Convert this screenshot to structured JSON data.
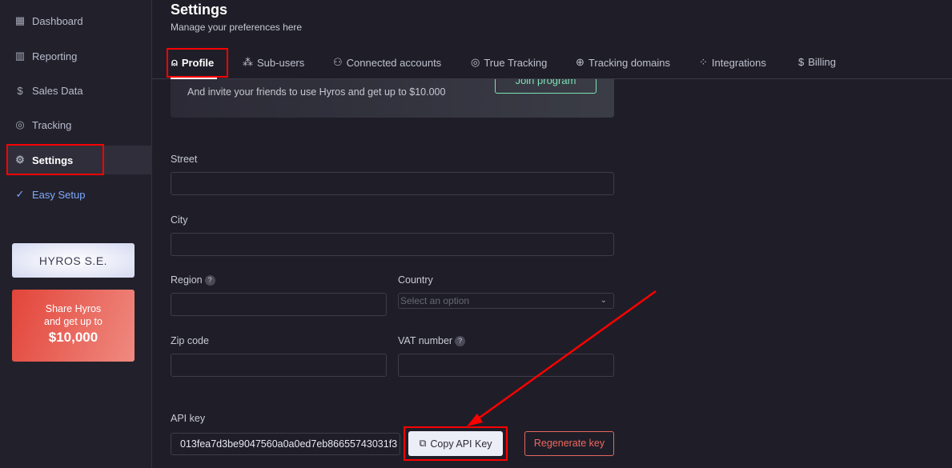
{
  "sidebar": {
    "items": [
      {
        "label": "Dashboard",
        "icon": "grid-icon"
      },
      {
        "label": "Reporting",
        "icon": "chart-icon"
      },
      {
        "label": "Sales Data",
        "icon": "dollar-icon"
      },
      {
        "label": "Tracking",
        "icon": "target-icon"
      },
      {
        "label": "Settings",
        "icon": "gear-icon"
      },
      {
        "label": "Easy Setup",
        "icon": "check-circle-icon"
      }
    ],
    "se_label": "HYROS S.E.",
    "share": {
      "line1": "Share Hyros",
      "line2": "and get up to",
      "amount": "$10,000"
    }
  },
  "header": {
    "title": "Settings",
    "subtitle": "Manage your preferences here"
  },
  "tabs": [
    "Profile",
    "Sub-users",
    "Connected accounts",
    "True Tracking",
    "Tracking domains",
    "Integrations",
    "Billing"
  ],
  "banner": {
    "text": "And invite your friends to use Hyros and get up to $10.000",
    "button": "Join program"
  },
  "form": {
    "street": "Street",
    "city": "City",
    "region": "Region",
    "country": "Country",
    "country_placeholder": "Select an option",
    "zip": "Zip code",
    "vat": "VAT number",
    "help": "?"
  },
  "api": {
    "label": "API key",
    "value": "013fea7d3be9047560a0a0ed7eb86655743031f3",
    "copy": "Copy API Key",
    "regenerate": "Regenerate key"
  },
  "colors": {
    "accent_red": "#f0675e",
    "join_green": "#7de3b3",
    "highlight": "#ff0000"
  }
}
